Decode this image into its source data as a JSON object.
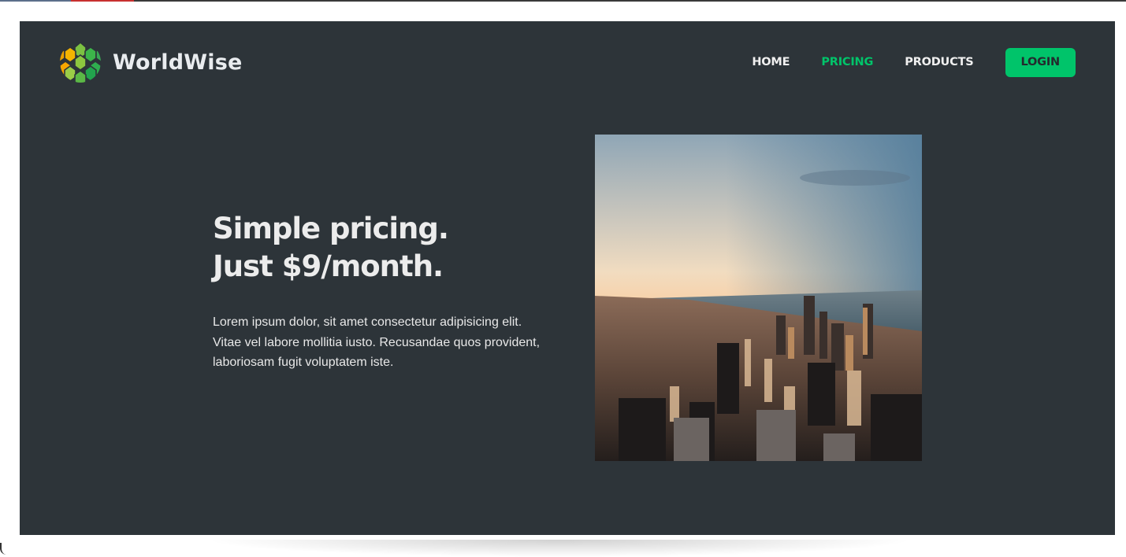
{
  "brand": {
    "name": "WorldWise",
    "logo_icon": "globe-hexagon-icon"
  },
  "nav": {
    "items": [
      {
        "label": "HOME",
        "active": false
      },
      {
        "label": "PRICING",
        "active": true
      },
      {
        "label": "PRODUCTS",
        "active": false
      }
    ],
    "login_label": "LOGIN"
  },
  "hero": {
    "title_line1": "Simple pricing.",
    "title_line2": "Just $9/month.",
    "description": "Lorem ipsum dolor, sit amet consectetur adipisicing elit. Vitae vel labore mollitia iusto. Recusandae quos provident, laboriosam fugit voluptatem iste.",
    "image": "city-skyline-photo"
  },
  "colors": {
    "background": "#2d3439",
    "accent": "#00c46a",
    "text": "#ececec"
  }
}
